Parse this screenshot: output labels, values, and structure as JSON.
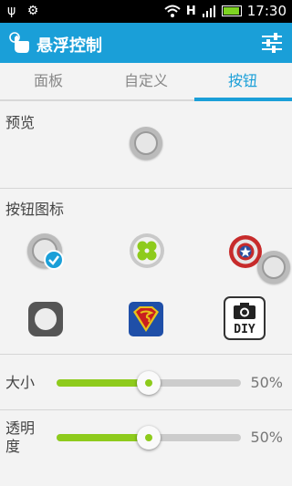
{
  "status_bar": {
    "time": "17:30",
    "network": "H",
    "left_icons": [
      "usb-icon",
      "android-debug-icon"
    ]
  },
  "action_bar": {
    "title": "悬浮控制",
    "app_icon": "touch-hand-icon",
    "settings_icon": "equalizer-icon"
  },
  "tabs": [
    {
      "label": "面板",
      "active": false
    },
    {
      "label": "自定义",
      "active": false
    },
    {
      "label": "按钮",
      "active": true
    }
  ],
  "preview": {
    "label": "预览"
  },
  "button_icons": {
    "label": "按钮图标",
    "items": [
      {
        "name": "default-round-icon",
        "selected": true
      },
      {
        "name": "clover-icon",
        "selected": false
      },
      {
        "name": "captain-america-shield-icon",
        "selected": false
      },
      {
        "name": "rounded-square-icon",
        "selected": false
      },
      {
        "name": "superman-icon",
        "selected": false
      },
      {
        "name": "camera-diy-icon",
        "selected": false,
        "text": "DIY"
      }
    ]
  },
  "size": {
    "label": "大小",
    "value_text": "50%",
    "value": 0.5
  },
  "opacity": {
    "label": "透明度",
    "label_line1": "透明",
    "label_line2": "度",
    "value_text": "50%",
    "value": 0.5
  },
  "colors": {
    "accent": "#1a9fd8",
    "slider": "#8ecb1c"
  }
}
